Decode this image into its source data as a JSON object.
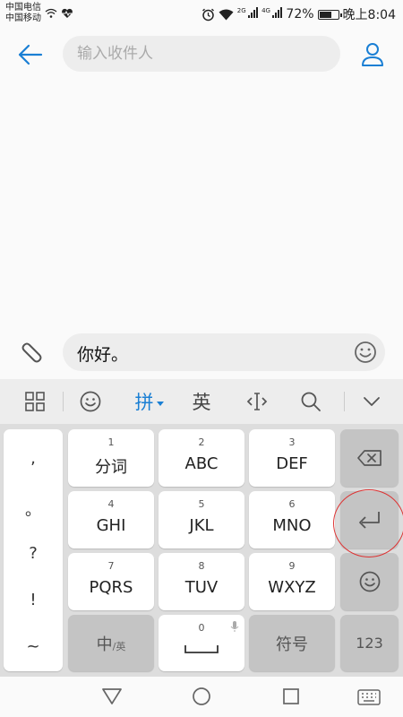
{
  "status_bar": {
    "carrier_1": "中国电信",
    "carrier_2": "中国移动",
    "net_2g": "2G",
    "net_4g": "4G",
    "battery_percent": "72%",
    "battery_level": 0.72,
    "time": "晚上8:04"
  },
  "header": {
    "recipient_placeholder": "输入收件人"
  },
  "compose": {
    "message_text": "你好。"
  },
  "ime_toolbar": {
    "pinyin_label": "拼",
    "english_label": "英"
  },
  "keyboard": {
    "punctuation": [
      ",",
      "。",
      "?",
      "!",
      "~"
    ],
    "keys": [
      {
        "num": "1",
        "label": "分词"
      },
      {
        "num": "2",
        "label": "ABC"
      },
      {
        "num": "3",
        "label": "DEF"
      },
      {
        "num": "4",
        "label": "GHI"
      },
      {
        "num": "5",
        "label": "JKL"
      },
      {
        "num": "6",
        "label": "MNO"
      },
      {
        "num": "7",
        "label": "PQRS"
      },
      {
        "num": "8",
        "label": "TUV"
      },
      {
        "num": "9",
        "label": "WXYZ"
      }
    ],
    "lang_switch_main": "中",
    "lang_switch_sub": "/英",
    "space_num": "0",
    "symbols_label": "符号",
    "numeric_label": "123"
  },
  "colors": {
    "accent": "#1a7fd4",
    "highlight": "#dd3333"
  }
}
